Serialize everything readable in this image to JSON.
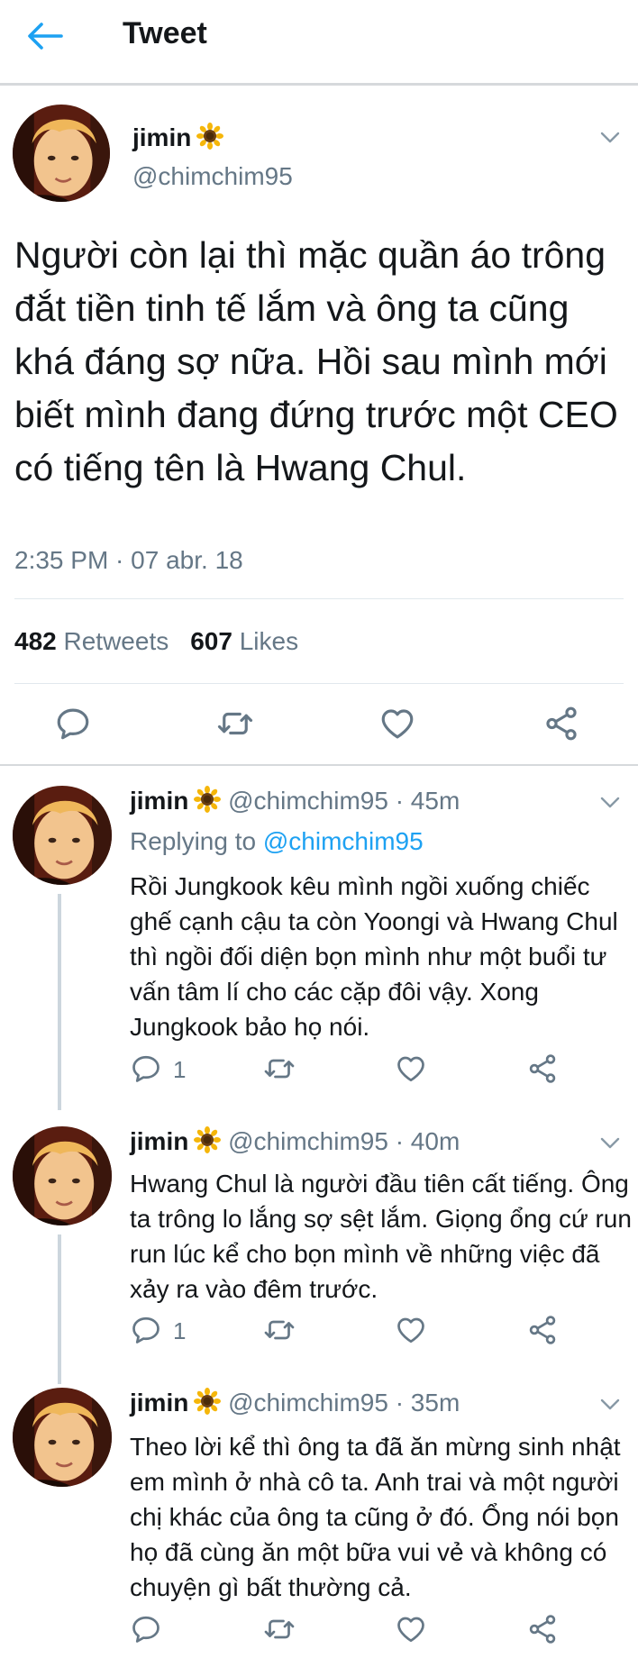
{
  "header": {
    "title": "Tweet"
  },
  "main": {
    "name": "jimin",
    "handle": "@chimchim95",
    "text": "Người còn lại thì mặc quần áo trông đắt tiền tinh tế lắm và ông ta cũng khá đáng sợ nữa. Hồi sau mình mới biết mình đang đứng trước một CEO có tiếng tên là Hwang Chul.",
    "timestamp": "2:35 PM · 07 abr. 18",
    "retweets_count": "482",
    "retweets_label": "Retweets",
    "likes_count": "607",
    "likes_label": "Likes"
  },
  "replies": [
    {
      "name": "jimin",
      "handle": "@chimchim95 · 45m",
      "replying_prefix": "Replying to",
      "replying_to": "@chimchim95",
      "text": "Rồi Jungkook kêu mình ngồi xuống chiếc ghế cạnh cậu ta còn Yoongi và Hwang Chul thì ngồi đối diện bọn mình như một buổi tư vấn tâm lí cho các cặp đôi vậy. Xong Jungkook bảo họ nói.",
      "reply_count": "1"
    },
    {
      "name": "jimin",
      "handle": "@chimchim95 · 40m",
      "text": "Hwang Chul là người đầu tiên cất tiếng. Ông ta trông lo lắng sợ sệt lắm. Giọng ổng cứ run run lúc kể cho bọn mình về những việc đã xảy ra vào đêm trước.",
      "reply_count": "1"
    },
    {
      "name": "jimin",
      "handle": "@chimchim95 · 35m",
      "text": "Theo lời kể thì ông ta đã ăn mừng sinh nhật em mình ở nhà cô ta. Anh trai và một người chị khác của ông ta cũng ở đó. Ổng nói bọn họ đã cùng ăn một bữa vui vẻ và không có chuyện gì bất thường cả.",
      "reply_count": ""
    }
  ],
  "icons": {
    "back": "arrow-left-icon",
    "verified_emoji": "sunflower-icon",
    "reply": "comment-icon",
    "retweet": "retweet-icon",
    "like": "heart-icon",
    "share": "share-icon",
    "more": "chevron-down-icon"
  },
  "colors": {
    "accent": "#1da1f2",
    "muted": "#657786",
    "text": "#14171a",
    "thread": "#ccd6dd"
  }
}
